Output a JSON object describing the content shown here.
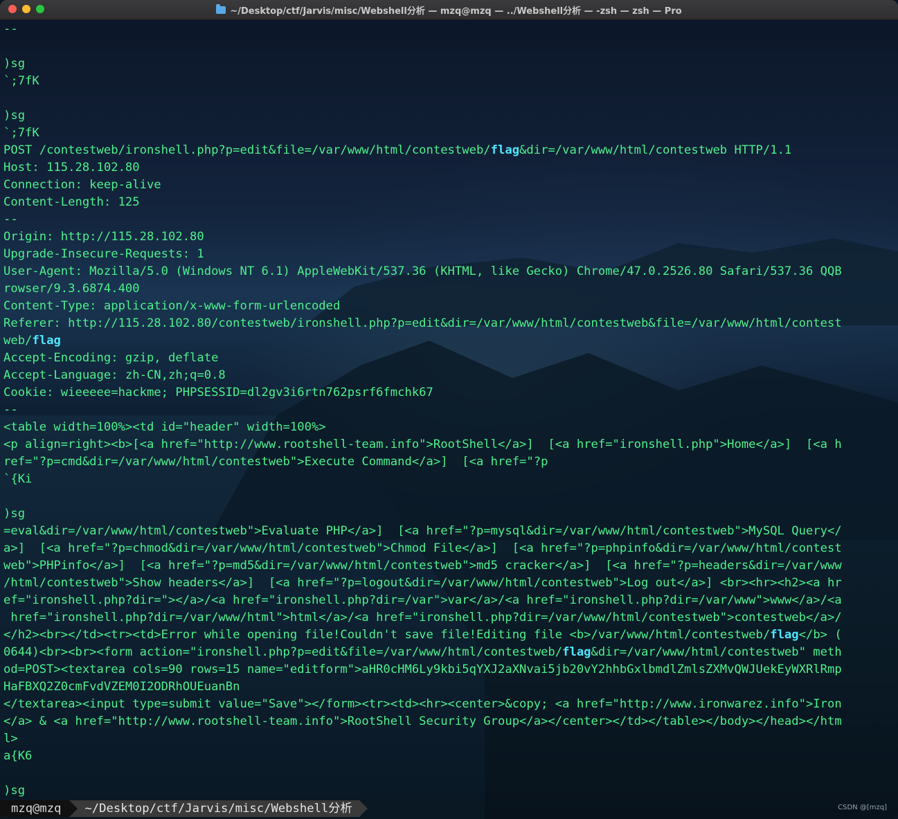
{
  "window": {
    "title": "~/Desktop/ctf/Jarvis/misc/Webshell分析 — mzq@mzq — ../Webshell分析 — -zsh — zsh — Pro"
  },
  "terminal": {
    "lines": [
      "--",
      "",
      ")sg",
      "`;7fK",
      "",
      ")sg",
      "`;7fK",
      "POST /contestweb/ironshell.php?p=edit&file=/var/www/html/contestweb/flag&dir=/var/www/html/contestweb HTTP/1.1",
      "Host: 115.28.102.80",
      "Connection: keep-alive",
      "Content-Length: 125",
      "--",
      "Origin: http://115.28.102.80",
      "Upgrade-Insecure-Requests: 1",
      "User-Agent: Mozilla/5.0 (Windows NT 6.1) AppleWebKit/537.36 (KHTML, like Gecko) Chrome/47.0.2526.80 Safari/537.36 QQB",
      "rowser/9.3.6874.400",
      "Content-Type: application/x-www-form-urlencoded",
      "Referer: http://115.28.102.80/contestweb/ironshell.php?p=edit&dir=/var/www/html/contestweb&file=/var/www/html/contest",
      "web/flag",
      "Accept-Encoding: gzip, deflate",
      "Accept-Language: zh-CN,zh;q=0.8",
      "Cookie: wieeeee=hackme; PHPSESSID=dl2gv3i6rtn762psrf6fmchk67",
      "--",
      "<table width=100%><td id=\"header\" width=100%>",
      "<p align=right><b>[<a href=\"http://www.rootshell-team.info\">RootShell</a>]  [<a href=\"ironshell.php\">Home</a>]  [<a h",
      "ref=\"?p=cmd&dir=/var/www/html/contestweb\">Execute Command</a>]  [<a href=\"?p",
      "`{Ki",
      "",
      ")sg",
      "=eval&dir=/var/www/html/contestweb\">Evaluate PHP</a>]  [<a href=\"?p=mysql&dir=/var/www/html/contestweb\">MySQL Query</",
      "a>]  [<a href=\"?p=chmod&dir=/var/www/html/contestweb\">Chmod File</a>]  [<a href=\"?p=phpinfo&dir=/var/www/html/contest",
      "web\">PHPinfo</a>]  [<a href=\"?p=md5&dir=/var/www/html/contestweb\">md5 cracker</a>]  [<a href=\"?p=headers&dir=/var/www",
      "/html/contestweb\">Show headers</a>]  [<a href=\"?p=logout&dir=/var/www/html/contestweb\">Log out</a>] <br><hr><h2><a hr",
      "ef=\"ironshell.php?dir=\"></a>/<a href=\"ironshell.php?dir=/var\">var</a>/<a href=\"ironshell.php?dir=/var/www\">www</a>/<a",
      " href=\"ironshell.php?dir=/var/www/html\">html</a>/<a href=\"ironshell.php?dir=/var/www/html/contestweb\">contestweb</a>/",
      "</h2><br></td><tr><td>Error while opening file!Couldn't save file!Editing file <b>/var/www/html/contestweb/flag</b> (",
      "0644)<br><br><form action=\"ironshell.php?p=edit&file=/var/www/html/contestweb/flag&dir=/var/www/html/contestweb\" meth",
      "od=POST><textarea cols=90 rows=15 name=\"editform\">aHR0cHM6Ly9kbi5qYXJ2aXNvai5jb20vY2hhbGxlbmdlZmlsZXMvQWJUekEyWXRlRmp",
      "HaFBXQ2Z0cmFvdVZEM0I2ODRhOUEuanBn",
      "</textarea><input type=submit value=\"Save\"></form><tr><td><hr><center>&copy; <a href=\"http://www.ironwarez.info\">Iron",
      "</a> & <a href=\"http://www.rootshell-team.info\">RootShell Security Group</a></center></td></table></body></head></htm",
      "l>",
      "a{K6",
      "",
      ")sg"
    ],
    "highlight_word": "flag"
  },
  "prompt": {
    "user": "mzq@mzq",
    "path": "~/Desktop/ctf/Jarvis/misc/Webshell分析"
  },
  "watermark": "CSDN @[mzq]",
  "colors": {
    "text": "#4ef08c",
    "highlight": "#4fe7ff"
  }
}
